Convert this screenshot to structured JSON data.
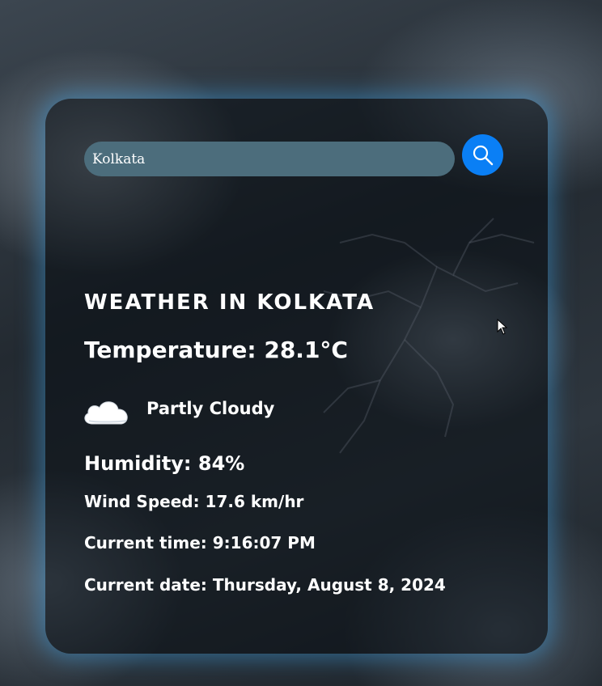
{
  "search": {
    "value": "Kolkata"
  },
  "weather": {
    "title": "WEATHER IN KOLKATA",
    "temperature": "Temperature: 28.1°C",
    "condition": "Partly Cloudy",
    "humidity": "Humidity: 84%",
    "wind_speed": "Wind Speed: 17.6 km/hr",
    "current_time": "Current time: 9:16:07 PM",
    "current_date": "Current date: Thursday, August 8, 2024"
  },
  "icons": {
    "search": "magnifier-icon",
    "weather": "partly-cloudy-night-icon"
  },
  "colors": {
    "search_button": "#0a7ff5",
    "input_bg": "#4c6d7c",
    "card_glow": "#3c96d2",
    "text": "#ffffff"
  }
}
